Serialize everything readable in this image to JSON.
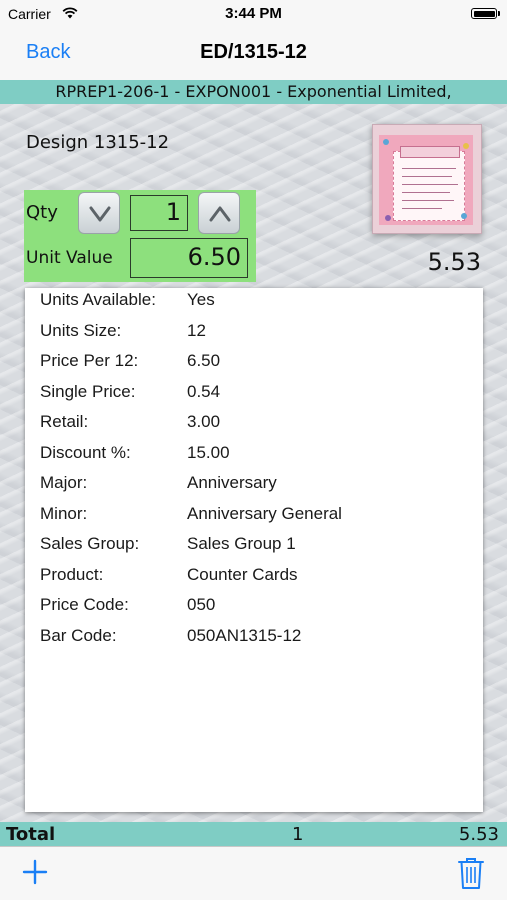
{
  "status_bar": {
    "carrier": "Carrier",
    "time": "3:44 PM"
  },
  "nav": {
    "back_label": "Back",
    "title": "ED/1315-12"
  },
  "customer_line": "RPREP1-206-1 - EXPON001 - Exponential Limited,",
  "design_label": "Design 1315-12",
  "qty": {
    "label": "Qty",
    "value": "1"
  },
  "unit_value": {
    "label": "Unit Value",
    "value": "6.50"
  },
  "line_total": "5.53",
  "details": [
    {
      "label": "Units Available:",
      "value": "Yes"
    },
    {
      "label": "Units Size:",
      "value": "12"
    },
    {
      "label": "Price Per 12:",
      "value": "6.50"
    },
    {
      "label": "Single Price:",
      "value": "0.54"
    },
    {
      "label": "Retail:",
      "value": "3.00"
    },
    {
      "label": "Discount %:",
      "value": "15.00"
    },
    {
      "label": "Major:",
      "value": "Anniversary"
    },
    {
      "label": "Minor:",
      "value": "Anniversary General"
    },
    {
      "label": "Sales Group:",
      "value": "Sales Group 1"
    },
    {
      "label": "Product:",
      "value": "Counter Cards"
    },
    {
      "label": "Price Code:",
      "value": "050"
    },
    {
      "label": "Bar Code:",
      "value": "050AN1315-12"
    }
  ],
  "totals": {
    "label": "Total",
    "qty": "1",
    "amount": "5.53"
  },
  "toolbar": {
    "add_icon": "plus-icon",
    "delete_icon": "trash-icon"
  },
  "colors": {
    "accent": "#1a7ff5",
    "teal_bar": "#7fcdc4",
    "green_panel": "#8de07d"
  }
}
